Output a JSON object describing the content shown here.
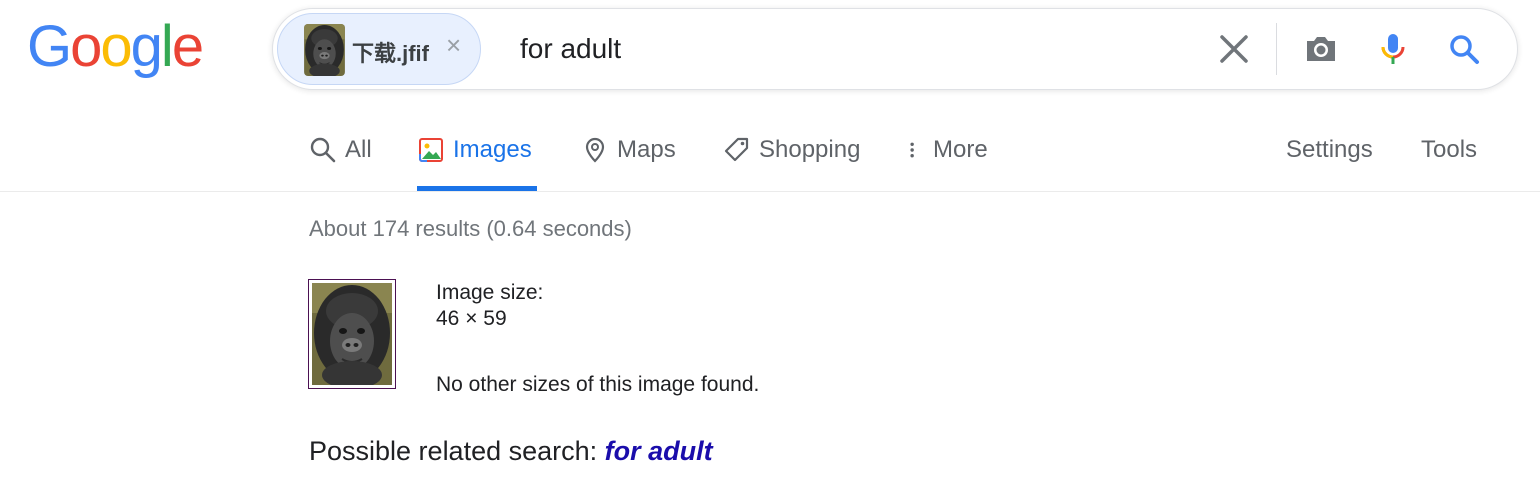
{
  "logo": {
    "text": "Google"
  },
  "search": {
    "image_chip_label": "下载.jfif",
    "query": "for adult"
  },
  "tabs": [
    {
      "label": "All",
      "icon": "search-icon"
    },
    {
      "label": "Images",
      "icon": "image-icon",
      "active": true
    },
    {
      "label": "Maps",
      "icon": "map-pin-icon"
    },
    {
      "label": "Shopping",
      "icon": "tag-icon"
    },
    {
      "label": "More",
      "icon": "more-vert-icon"
    }
  ],
  "right_links": {
    "settings": "Settings",
    "tools": "Tools"
  },
  "results": {
    "stats": "About 174 results (0.64 seconds)",
    "image_size_label": "Image size:",
    "image_size_value": "46 × 59",
    "no_other_sizes": "No other sizes of this image found.",
    "related_prefix": "Possible related search:",
    "related_query": "for adult"
  },
  "colors": {
    "accent": "#1a73e8",
    "link": "#1a0dab",
    "chip_bg": "#e8f0fe",
    "text_secondary": "#5f6368"
  }
}
